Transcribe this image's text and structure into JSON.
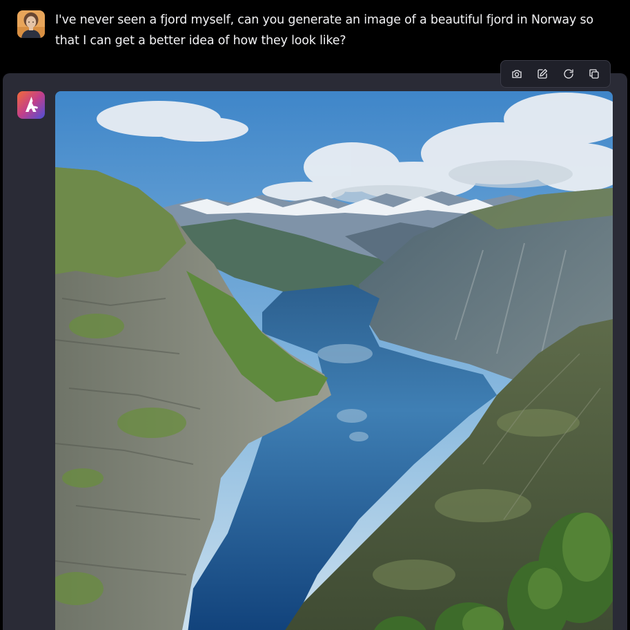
{
  "user_message": {
    "avatar": "user-avatar-photo",
    "text": "I've never seen a fjord myself, can you generate an image of a beautiful fjord in Norway so that I can get a better idea of how they look like?"
  },
  "assistant_message": {
    "avatar": "assistant-logo",
    "image": "generated-fjord-image"
  },
  "toolbar": {
    "items": [
      {
        "name": "camera-button",
        "icon": "camera-icon"
      },
      {
        "name": "edit-button",
        "icon": "edit-icon"
      },
      {
        "name": "regenerate-button",
        "icon": "refresh-icon"
      },
      {
        "name": "copy-button",
        "icon": "copy-icon"
      }
    ]
  },
  "colors": {
    "page_background": "#000000",
    "card_background": "#2a2b36",
    "text": "#f2f2f4",
    "toolbar_background": "#1f2029"
  }
}
